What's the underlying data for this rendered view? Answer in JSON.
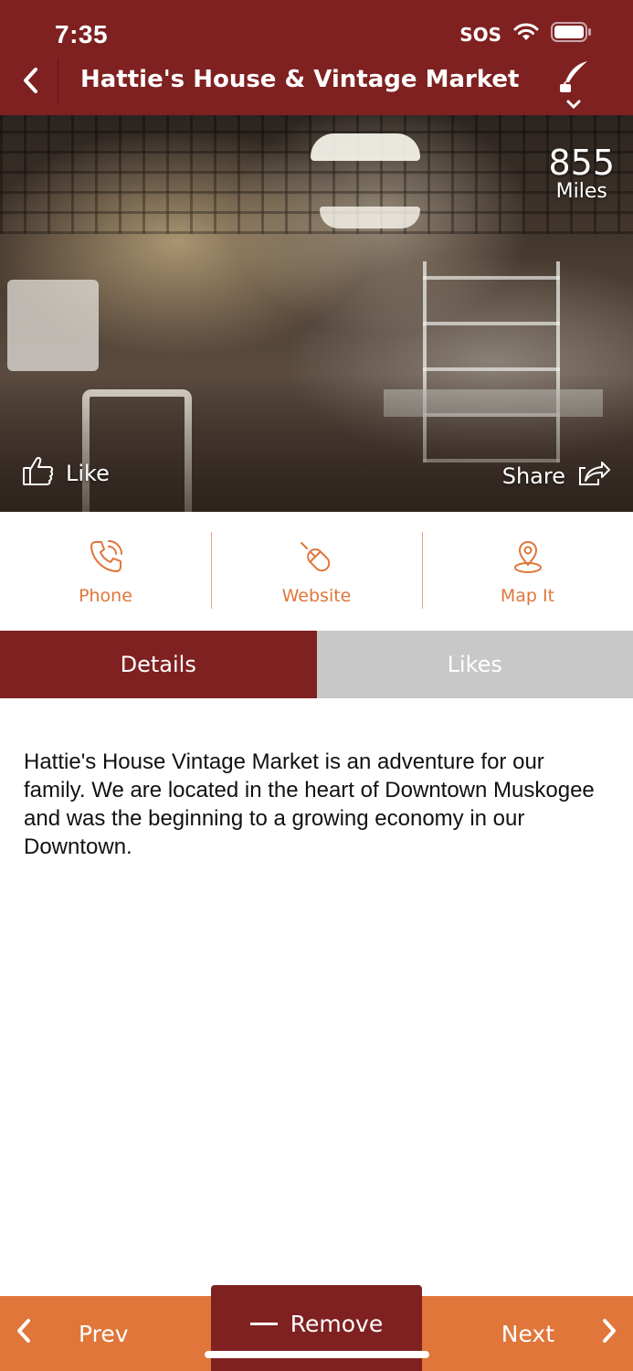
{
  "status_bar": {
    "time": "7:35",
    "sos": "SOS",
    "wifi_icon": "wifi-icon",
    "battery_icon": "battery-icon"
  },
  "header": {
    "title": "Hattie's House & Vintage Market",
    "back_icon": "chevron-left-icon",
    "quill_icon": "quill-icon"
  },
  "colors": {
    "brand_dark": "#7f2121",
    "accent_orange": "#e0763a",
    "tab_inactive": "#c8c8c8"
  },
  "hero": {
    "distance_value": "855",
    "distance_unit": "Miles",
    "like_label": "Like",
    "share_label": "Share"
  },
  "actions": [
    {
      "label": "Phone",
      "icon": "phone-icon"
    },
    {
      "label": "Website",
      "icon": "mouse-icon"
    },
    {
      "label": "Map It",
      "icon": "map-pin-icon"
    }
  ],
  "tabs": {
    "details": "Details",
    "likes": "Likes",
    "active": "Details"
  },
  "description": "Hattie's House Vintage Market is an adventure for our family. We are located in the heart of Downtown Muskogee and was the beginning to a growing economy in our Downtown.",
  "bottom_nav": {
    "prev": "Prev",
    "remove": "Remove",
    "next": "Next"
  }
}
